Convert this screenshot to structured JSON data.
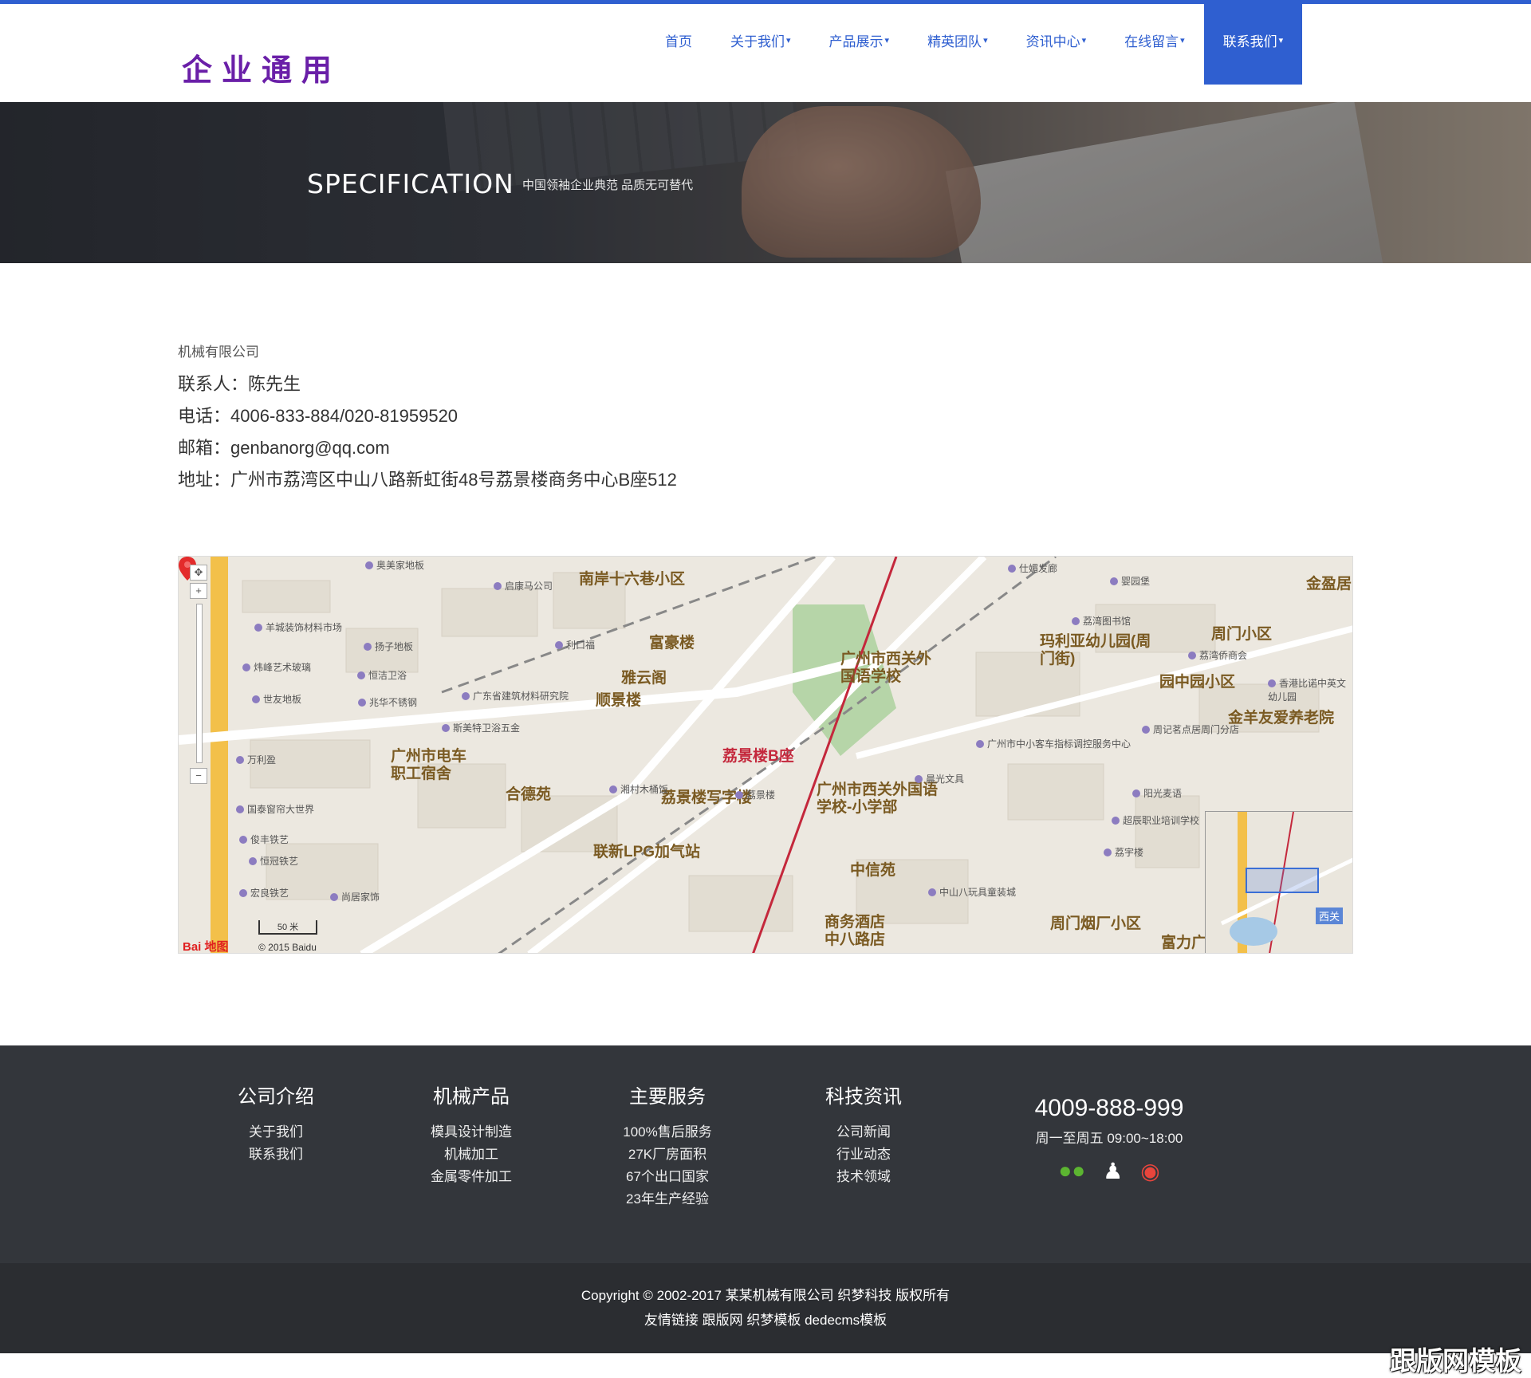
{
  "header": {
    "logo": "企业通用",
    "nav": [
      {
        "label": "首页",
        "caret": ""
      },
      {
        "label": "关于我们",
        "caret": "▾"
      },
      {
        "label": "产品展示",
        "caret": "▾"
      },
      {
        "label": "精英团队",
        "caret": "▾"
      },
      {
        "label": "资讯中心",
        "caret": "▾"
      },
      {
        "label": "在线留言",
        "caret": "▾"
      },
      {
        "label": "联系我们",
        "caret": "▾",
        "active": true
      }
    ]
  },
  "banner": {
    "title": "SPECIFICATION",
    "subtitle": "中国领袖企业典范  品质无可替代"
  },
  "contact": {
    "company": "机械有限公司",
    "person": "联系人：陈先生",
    "phone": "电话：4006-833-884/020-81959520",
    "email": "邮箱：genbanorg@qq.com",
    "address": "地址：广州市荔湾区中山八路新虹街48号荔景楼商务中心B座512"
  },
  "map": {
    "labels": [
      "南岸十六巷小区",
      "富豪楼",
      "雅云阁",
      "顺景楼",
      "广州市西关外国语学校",
      "玛利亚幼儿园(周门街)",
      "周门小区",
      "金盈居",
      "园中园小区",
      "金羊友爱养老院",
      "广州市电车职工宿舍",
      "合德苑",
      "荔景楼B座",
      "荔景楼写字楼",
      "广州市西关外国语学校-小学部",
      "联新LPG加气站",
      "中信苑",
      "商务酒店中八路店",
      "周门烟厂小区",
      "富力广"
    ],
    "pois": [
      "奥美家地板",
      "启康马公司",
      "羊城装饰材料市场",
      "扬子地板",
      "炜峰艺术玻璃",
      "恒洁卫浴",
      "广东省建筑材料研究院",
      "世友地板",
      "兆华不锈钢",
      "斯美特卫浴五金",
      "万利盈",
      "国泰窗帘大世界",
      "俊丰铁艺",
      "恒冠铁艺",
      "宏良铁艺",
      "尚居家饰",
      "利口福",
      "湘村木桶饭",
      "荔景楼",
      "晨光文具",
      "荔湾图书馆",
      "仕媚发廊",
      "婴园堡",
      "荔湾侨商会",
      "香港比诺中英文幼儿园",
      "周记茗点居周门分店",
      "阳光麦语",
      "超辰职业培训学校",
      "荔宇楼",
      "中山八玩具童装城",
      "广州市中小客车指标调控服务中心"
    ],
    "scale": "50 米",
    "logo": "Bai 地图",
    "copyright": "© 2015 Baidu",
    "overview_label": "西关"
  },
  "footer": {
    "columns": [
      {
        "title": "公司介绍",
        "links": [
          "关于我们",
          "联系我们"
        ]
      },
      {
        "title": "机械产品",
        "links": [
          "模具设计制造",
          "机械加工",
          "金属零件加工"
        ]
      },
      {
        "title": "主要服务",
        "links": [
          "100%售后服务",
          "27K厂房面积",
          "67个出口国家",
          "23年生产经验"
        ]
      },
      {
        "title": "科技资讯",
        "links": [
          "公司新闻",
          "行业动态",
          "技术领域"
        ]
      }
    ],
    "hotline": "4009-888-999",
    "hours": "周一至周五 09:00~18:00",
    "social": [
      {
        "icon": "wechat-icon",
        "glyph": "●●",
        "color": "#5cb531"
      },
      {
        "icon": "qq-icon",
        "glyph": "♟",
        "color": "#ffffff"
      },
      {
        "icon": "weibo-icon",
        "glyph": "◉",
        "color": "#e8453c"
      }
    ],
    "copyright": "Copyright © 2002-2017 某某机械有限公司 织梦科技 版权所有",
    "links": "友情链接 跟版网 织梦模板 dedecms模板"
  },
  "watermark": "跟版网模板"
}
